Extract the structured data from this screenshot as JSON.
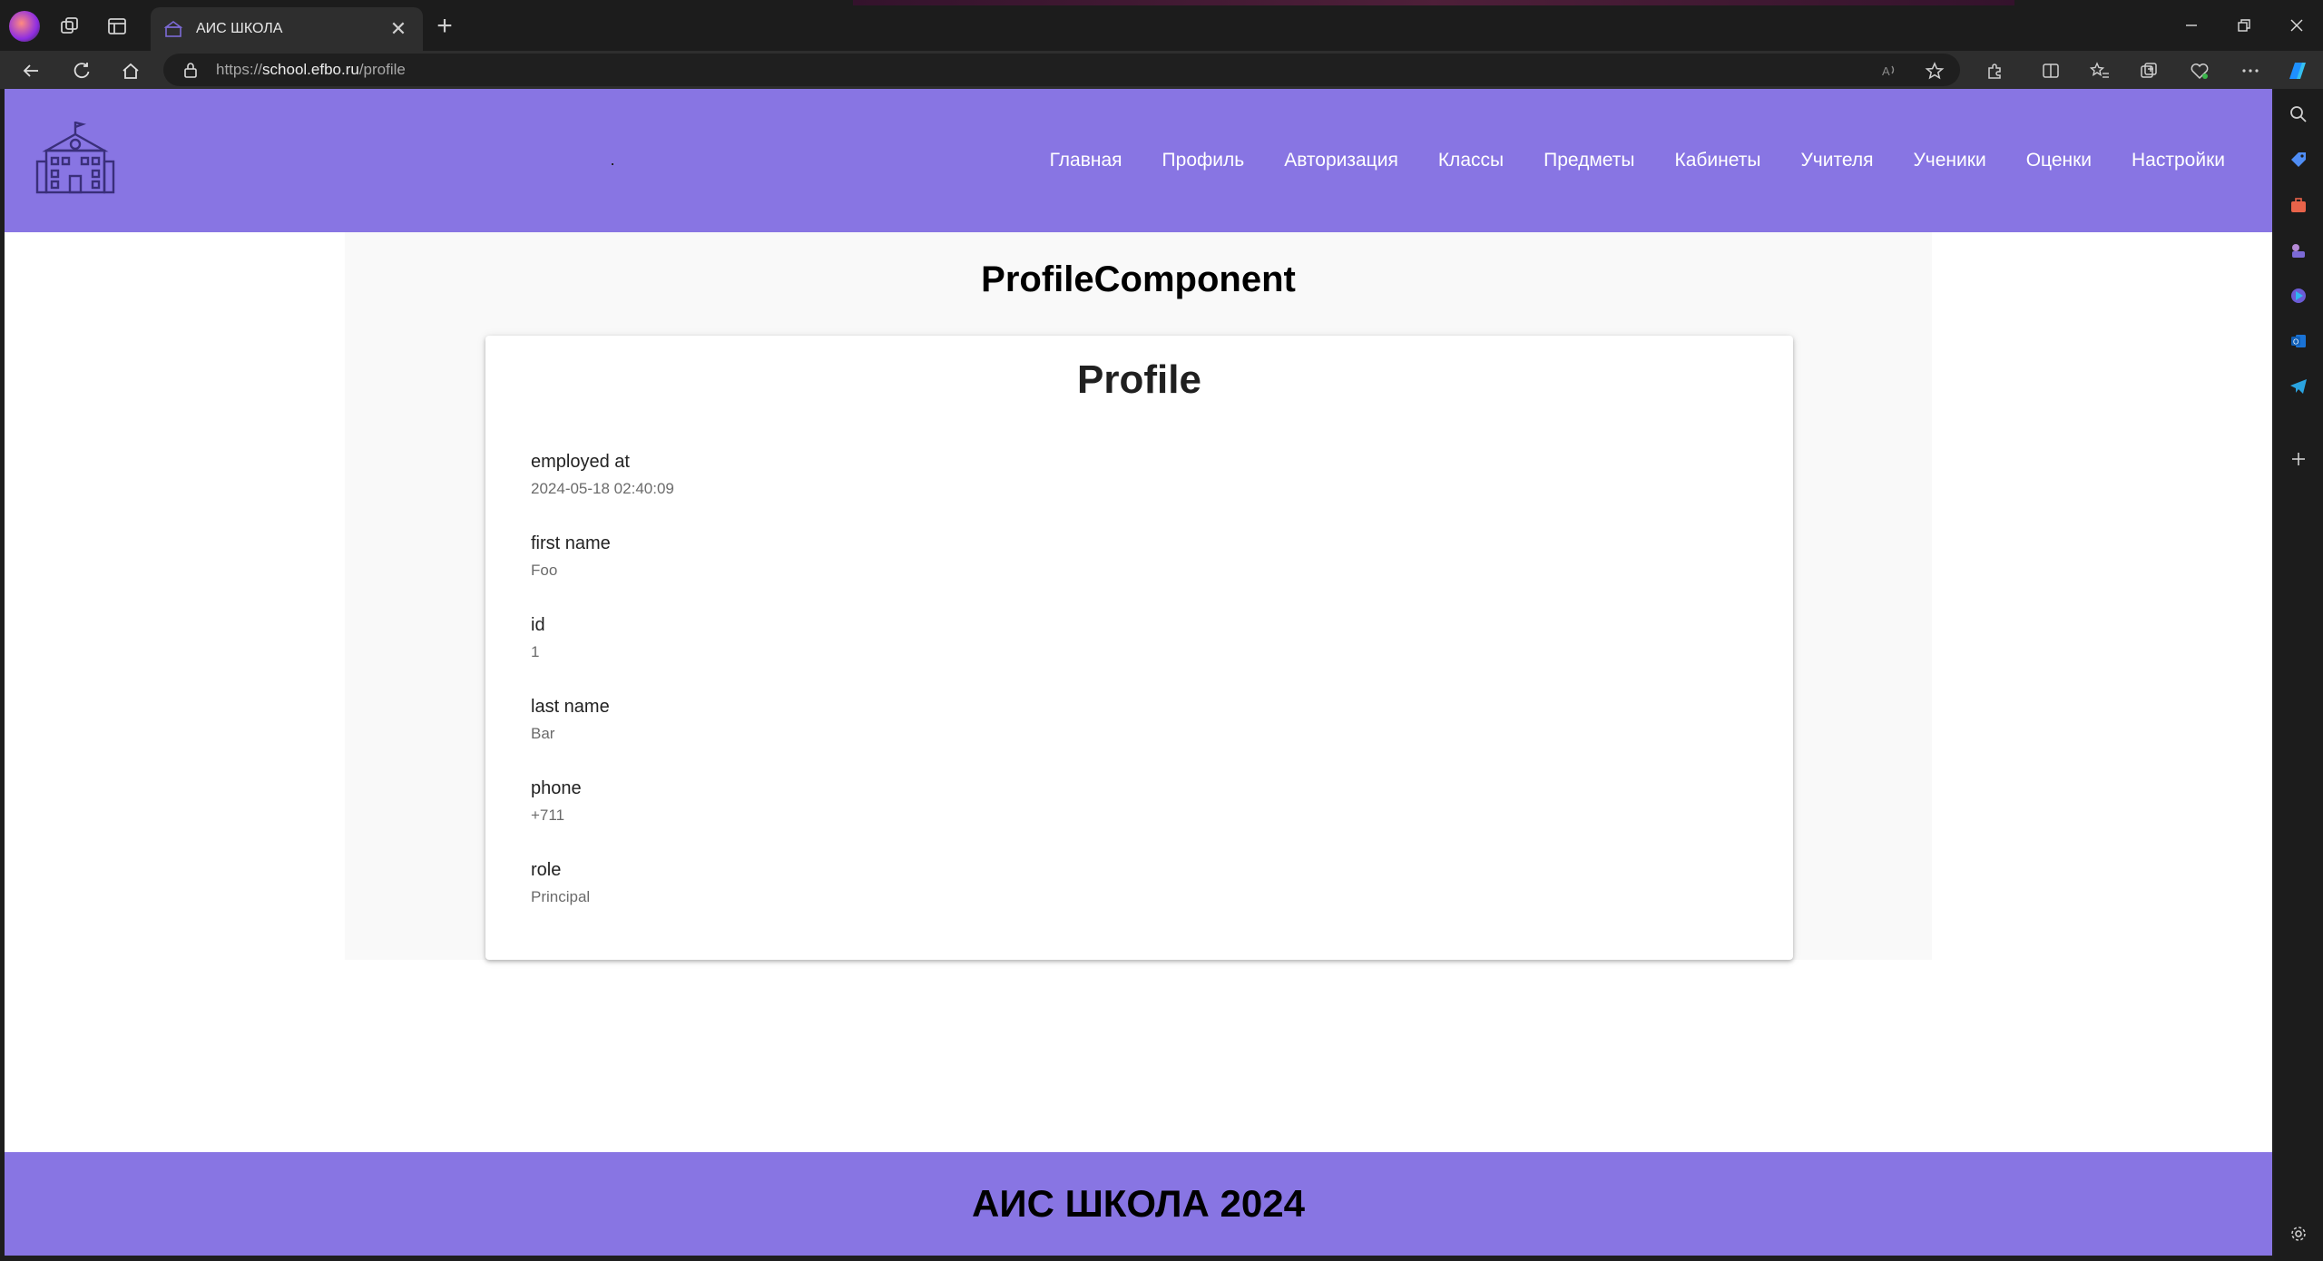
{
  "browser": {
    "tab_title": "АИС ШКОЛА",
    "url_prefix": "https://",
    "url_host": "school.efbo.ru",
    "url_path": "/profile"
  },
  "site": {
    "menu": [
      "Главная",
      "Профиль",
      "Авторизация",
      "Классы",
      "Предметы",
      "Кабинеты",
      "Учителя",
      "Ученики",
      "Оценки",
      "Настройки"
    ],
    "footer": "АИС ШКОЛА 2024"
  },
  "page": {
    "component_title": "ProfileComponent",
    "card_title": "Profile",
    "fields": [
      {
        "label": "employed at",
        "value": "2024-05-18 02:40:09"
      },
      {
        "label": "first name",
        "value": "Foo"
      },
      {
        "label": "id",
        "value": "1"
      },
      {
        "label": "last name",
        "value": "Bar"
      },
      {
        "label": "phone",
        "value": "+711"
      },
      {
        "label": "role",
        "value": "Principal"
      }
    ]
  },
  "colors": {
    "header_bg": "#8875e3",
    "panel_bg": "#f9f9f9",
    "browser_dark": "#1c1c1c"
  }
}
